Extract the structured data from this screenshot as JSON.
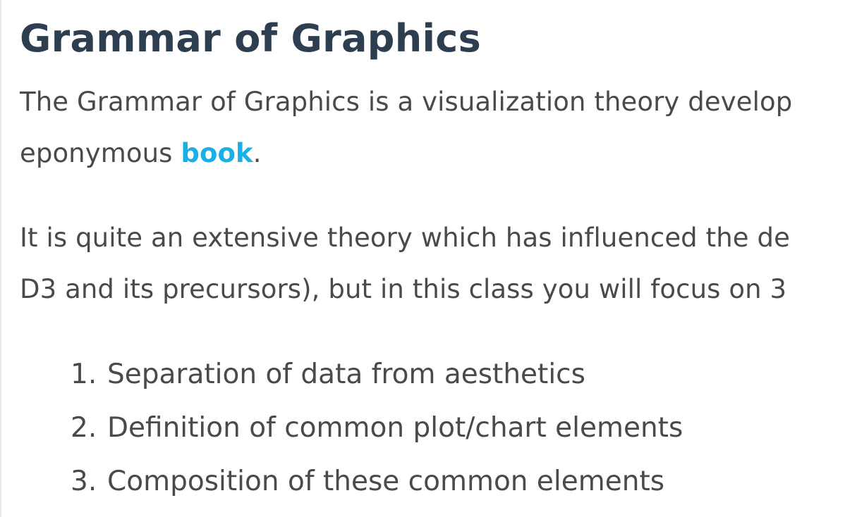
{
  "heading": "Grammar of Graphics",
  "paragraph1": {
    "line1": "The Grammar of Graphics is a visualization theory develop",
    "line2_before": "eponymous ",
    "link_text": "book",
    "line2_after": "."
  },
  "paragraph2": {
    "line1": "It is quite an extensive theory which has influenced the de",
    "line2": "D3 and its precursors), but in this class you will focus on 3"
  },
  "list": {
    "items": [
      {
        "number": "1.",
        "text": "Separation of data from aesthetics"
      },
      {
        "number": "2.",
        "text": "Definition of common plot/chart elements"
      },
      {
        "number": "3.",
        "text": "Composition of these common elements"
      }
    ]
  },
  "colors": {
    "heading": "#2c3e50",
    "body_text": "#4a4a4a",
    "link": "#1ab0e6"
  }
}
